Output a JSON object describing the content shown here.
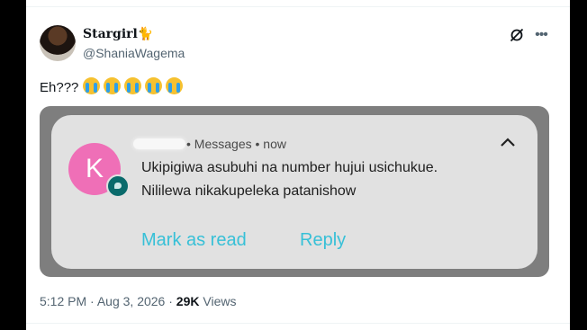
{
  "tweet": {
    "display_name": "Stargirl",
    "display_name_emoji": "🐈",
    "handle": "@ShaniaWagema",
    "text": "Eh???",
    "emojis": [
      "loudly-crying-face",
      "loudly-crying-face",
      "loudly-crying-face",
      "loudly-crying-face",
      "loudly-crying-face"
    ],
    "time": "5:12 PM",
    "separator": "·",
    "date": "Aug 3, 2026",
    "views_count": "29K",
    "views_label": "Views"
  },
  "notification": {
    "avatar_letter": "K",
    "app": "Messages",
    "meta_separator": "•",
    "time": "now",
    "message_line_1": "Ukipigiwa asubuhi na number hujui usichukue.",
    "message_line_2": "Nililewa nikakupeleka patanishow",
    "action_mark_read": "Mark as read",
    "action_reply": "Reply"
  },
  "colors": {
    "avatar_pink": "#ef6fb7",
    "action_cyan": "#37c0d7",
    "notification_bg": "#e1e1e1",
    "frame_gray": "#7e7e7e"
  }
}
